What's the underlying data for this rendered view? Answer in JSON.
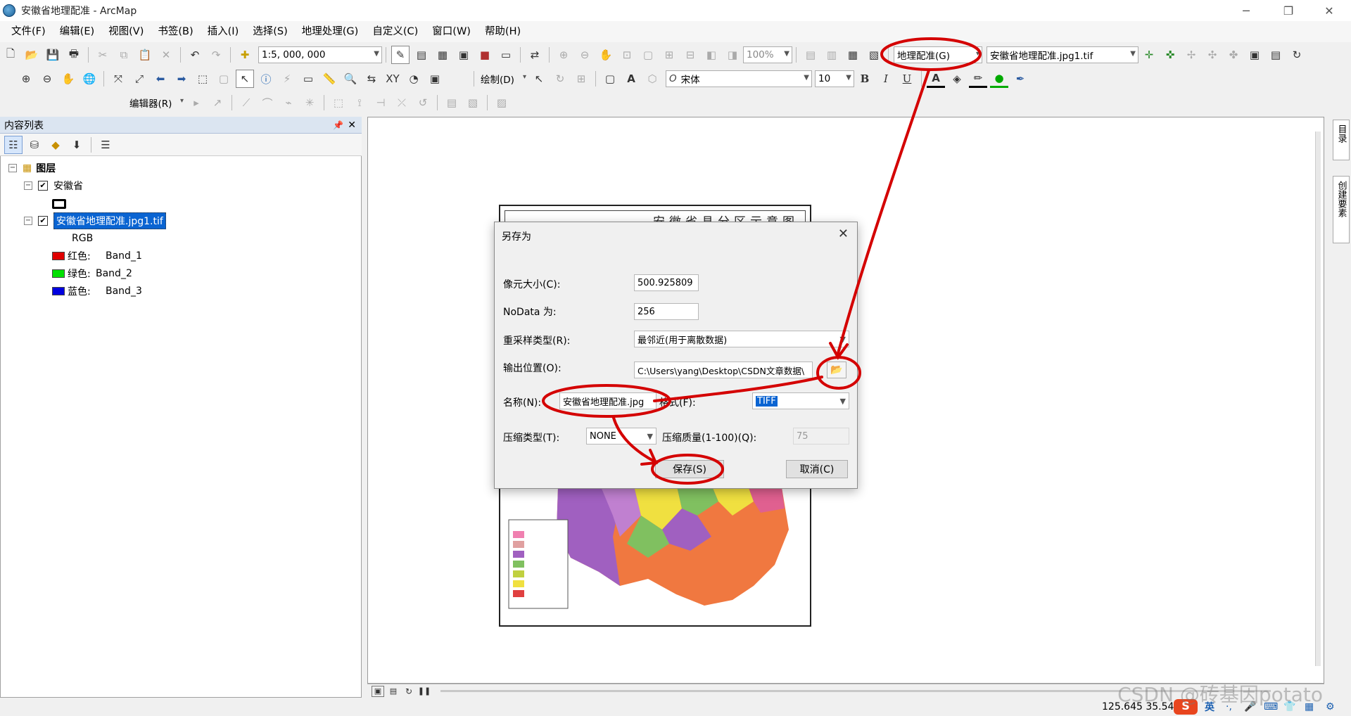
{
  "app": {
    "title": "安徽省地理配准 - ArcMap"
  },
  "menu": [
    "文件(F)",
    "编辑(E)",
    "视图(V)",
    "书签(B)",
    "插入(I)",
    "选择(S)",
    "地理处理(G)",
    "自定义(C)",
    "窗口(W)",
    "帮助(H)"
  ],
  "toolbar1": {
    "scale": "1:5, 000, 000",
    "zoom": "100%",
    "georef_menu": "地理配准(G)",
    "georef_layer": "安徽省地理配准.jpg1.tif"
  },
  "toolbar2": {
    "draw_menu": "绘制(D)",
    "font": "宋体",
    "font_size": "10",
    "bold": "B",
    "italic": "I",
    "underline": "U",
    "text_tool": "A"
  },
  "toolbar3": {
    "editor_menu": "编辑器(R)"
  },
  "toc": {
    "title": "内容列表",
    "root_label": "图层",
    "layers": [
      {
        "name": "安徽省"
      },
      {
        "name": "安徽省地理配准.jpg1.tif",
        "sub": "RGB",
        "bands": [
          {
            "channel": "红色:",
            "band": "Band_1",
            "color": "#e00000"
          },
          {
            "channel": "绿色:",
            "band": "Band_2",
            "color": "#00e000"
          },
          {
            "channel": "蓝色:",
            "band": "Band_3",
            "color": "#0000e0"
          }
        ]
      }
    ]
  },
  "map": {
    "title_fragment": "安徽省县分区示意图"
  },
  "dialog": {
    "title": "另存为",
    "cell_size_label": "像元大小(C):",
    "cell_size": "500.925809",
    "nodata_label": "NoData 为:",
    "nodata": "256",
    "resample_label": "重采样类型(R):",
    "resample": "最邻近(用于离散数据)",
    "output_label": "输出位置(O):",
    "output": "C:\\Users\\yang\\Desktop\\CSDN文章数据\\",
    "name_label": "名称(N):",
    "name": "安徽省地理配准.jpg",
    "format_label": "格式(F):",
    "format": "TIFF",
    "compress_label": "压缩类型(T):",
    "compress": "NONE",
    "quality_label": "压缩质量(1-100)(Q):",
    "quality": "75",
    "save": "保存(S)",
    "cancel": "取消(C)"
  },
  "right_dock": {
    "tab1": "目录",
    "tab2": "创建要素"
  },
  "status": {
    "coords": "125.645  35.54",
    "ime": "英"
  },
  "watermark": "CSDN @砖基因potato",
  "colors": {
    "annotation": "#d40000",
    "selection": "#0a64d2"
  }
}
